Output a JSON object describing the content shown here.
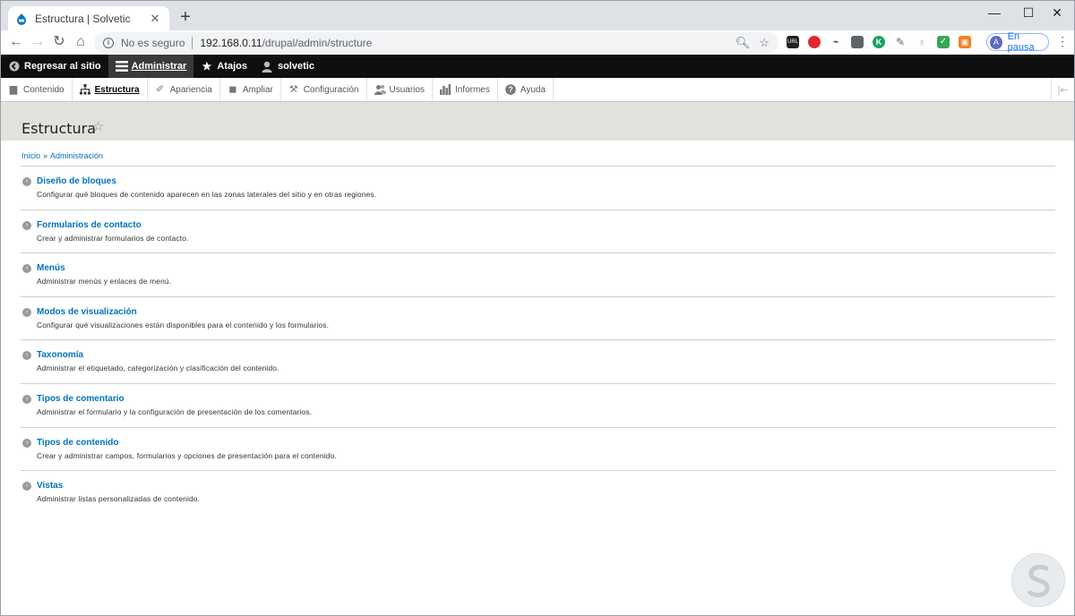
{
  "browser": {
    "tab_title": "Estructura | Solvetic",
    "omnibox": {
      "security_text": "No es seguro",
      "host": "192.168.0.11",
      "path": "/drupal/admin/structure"
    },
    "extensions": [
      "url-icon",
      "opera-icon",
      "bird-icon",
      "cube-icon",
      "k-icon",
      "pen-icon",
      "bulb-icon",
      "shield-check-icon",
      "lock-icon"
    ],
    "profile": {
      "avatar_letter": "A",
      "label": "En pausa"
    }
  },
  "adminbar": {
    "back": "Regresar al sitio",
    "manage": "Administrar",
    "shortcuts": "Atajos",
    "user": "solvetic"
  },
  "tray": {
    "items": [
      {
        "label": "Contenido",
        "icon": "file-icon"
      },
      {
        "label": "Estructura",
        "icon": "sitemap-icon",
        "active": true
      },
      {
        "label": "Apariencia",
        "icon": "paintbrush-icon"
      },
      {
        "label": "Ampliar",
        "icon": "puzzle-icon"
      },
      {
        "label": "Configuración",
        "icon": "wrench-icon"
      },
      {
        "label": "Usuarios",
        "icon": "people-icon"
      },
      {
        "label": "Informes",
        "icon": "bar-chart-icon"
      },
      {
        "label": "Ayuda",
        "icon": "help-icon"
      }
    ]
  },
  "page": {
    "title": "Estructura",
    "breadcrumb": [
      "Inicio",
      "Administración"
    ],
    "items": [
      {
        "title": "Diseño de bloques",
        "description": "Configurar qué bloques de contenido aparecen en las zonas laterales del sitio y en otras regiones."
      },
      {
        "title": "Formularios de contacto",
        "description": "Crear y administrar formularios de contacto."
      },
      {
        "title": "Menús",
        "description": "Administrar menús y enlaces de menú."
      },
      {
        "title": "Modos de visualización",
        "description": "Configurar qué visualizaciones están disponibles para el contenido y los formularios."
      },
      {
        "title": "Taxonomía",
        "description": "Administrar el etiquetado, categorización y clasificación del contenido."
      },
      {
        "title": "Tipos de comentario",
        "description": "Administrar el formulario y la configuración de presentación de los comentarios."
      },
      {
        "title": "Tipos de contenido",
        "description": "Crear y administrar campos, formularios y opciones de presentación para el contenido."
      },
      {
        "title": "Vistas",
        "description": "Administrar listas personalizadas de contenido."
      }
    ]
  }
}
